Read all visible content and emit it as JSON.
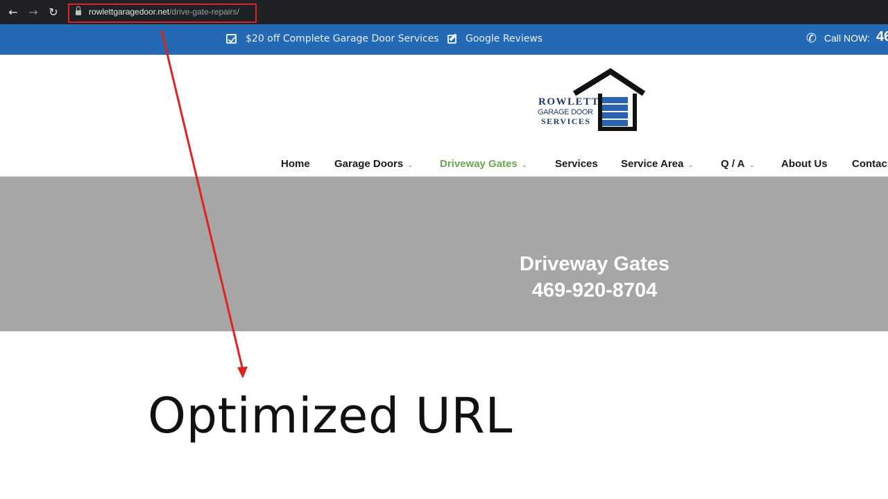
{
  "browser": {
    "url_domain": "rowlettgaragedoor.net",
    "url_path": "/drive-gate-repairs/"
  },
  "topbar": {
    "promo_1": "$20 off Complete Garage Door Services",
    "promo_2": "Google Reviews",
    "call_label": "Call NOW:",
    "call_number": "46"
  },
  "logo": {
    "line1": "ROWLETT",
    "line2": "GARAGE DOOR",
    "line3": "SERVICES",
    "colors": {
      "roof": "#111111",
      "door": "#2b63b3",
      "text": "#1f3a73"
    }
  },
  "nav": {
    "items": [
      {
        "label": "Home",
        "dropdown": false,
        "active": false
      },
      {
        "label": "Garage Doors",
        "dropdown": true,
        "active": false
      },
      {
        "label": "Driveway Gates",
        "dropdown": true,
        "active": true
      },
      {
        "label": "Services",
        "dropdown": false,
        "active": false
      },
      {
        "label": "Service Area",
        "dropdown": true,
        "active": false
      },
      {
        "label": "Q / A",
        "dropdown": true,
        "active": false
      },
      {
        "label": "About Us",
        "dropdown": false,
        "active": false
      },
      {
        "label": "Contac",
        "dropdown": false,
        "active": false
      }
    ]
  },
  "hero": {
    "title": "Driveway Gates",
    "phone": "469-920-8704"
  },
  "annotation": {
    "caption": "Optimized URL",
    "color": "#e0211e"
  },
  "colors": {
    "topbar": "#2469b3",
    "hero": "#a6a6a6",
    "active_nav": "#6aa84f",
    "chrome": "#202124"
  }
}
